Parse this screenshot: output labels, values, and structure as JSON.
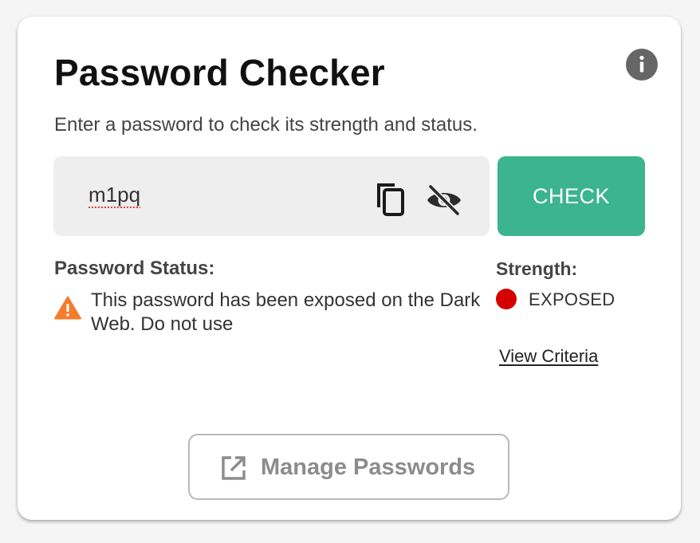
{
  "app": {
    "title": "Password Checker",
    "subtitle": "Enter a password to check its strength and status."
  },
  "icons": {
    "info": "info-icon",
    "copy": "copy-icon",
    "visibility": "eye-off-icon",
    "warning": "warning-triangle-icon",
    "external": "external-link-icon"
  },
  "password": {
    "value": "m1pq"
  },
  "actions": {
    "check_label": "CHECK",
    "manage_label": "Manage Passwords",
    "criteria_label": "View Criteria"
  },
  "status": {
    "label": "Password Status:",
    "message": "This password has been exposed on the Dark Web. Do not use"
  },
  "strength": {
    "label": "Strength:",
    "value": "EXPOSED"
  },
  "colors": {
    "accent": "#3cb48e",
    "danger": "#d50000",
    "warning": "#f57c2c"
  }
}
